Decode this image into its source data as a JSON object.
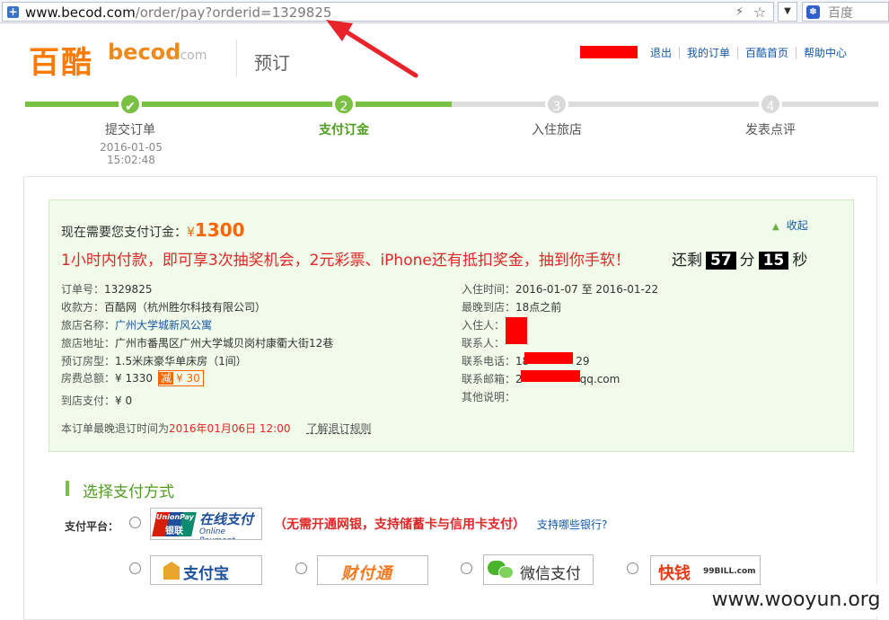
{
  "browser": {
    "url_host": "www.becod.com",
    "url_path": "/order/pay?orderid=1329825",
    "search_engine": "百度"
  },
  "header": {
    "logo_cn": "百酷",
    "logo_en": "becod",
    "logo_com": ".com",
    "page_heading": "预订",
    "nav": [
      "退出",
      "我的订单",
      "百酷首页",
      "帮助中心"
    ]
  },
  "steps": [
    {
      "label": "提交订单",
      "time": "2016-01-05 15:02:48",
      "status": "done",
      "mark": "✔"
    },
    {
      "label": "支付订金",
      "status": "current",
      "mark": "2"
    },
    {
      "label": "入住旅店",
      "status": "todo",
      "mark": "3"
    },
    {
      "label": "发表点评",
      "status": "todo",
      "mark": "4"
    }
  ],
  "order": {
    "amount_label": "现在需要您支付订金：",
    "currency": "¥",
    "amount": "1300",
    "collapse": "收起",
    "promo": "1小时内付款，即可享3次抽奖机会，2元彩票、iPhone还有抵扣奖金，抽到你手软！",
    "countdown_prefix": "还剩",
    "countdown_min": "57",
    "countdown_min_unit": "分",
    "countdown_sec": "15",
    "countdown_sec_unit": "秒",
    "left": [
      {
        "label": "订单号：",
        "value": "1329825"
      },
      {
        "label": "收款方：",
        "value": "百酷网（杭州胜尔科技有限公司）"
      },
      {
        "label": "旅店名称：",
        "value": "广州大学城新风公寓"
      },
      {
        "label": "旅店地址：",
        "value": "广州市番禺区广州大学城贝岗村康衢大街12巷"
      },
      {
        "label": "预订房型：",
        "value": "1.5米床豪华单床房（1间）"
      },
      {
        "label": "房费总额：",
        "value": "¥ 1330"
      },
      {
        "label": "到店支付：",
        "value": "¥ 0"
      }
    ],
    "discount_tag": "减",
    "discount_amount": "¥ 30",
    "right": [
      {
        "label": "入住时间：",
        "value": "2016-01-07 至 2016-01-22"
      },
      {
        "label": "最晚到店：",
        "value": "18点之前"
      },
      {
        "label": "入住人：",
        "value": ""
      },
      {
        "label": "联系人：",
        "value": ""
      },
      {
        "label": "联系电话：",
        "value": "18",
        "value_tail": "29"
      },
      {
        "label": "联系邮箱：",
        "value": "2",
        "value_tail": "qq.com"
      },
      {
        "label": "其他说明：",
        "value": ""
      }
    ],
    "refund_prefix": "本订单最晚退订时间为",
    "refund_deadline": "2016年01月06日 12:00",
    "refund_link": "了解退订规则"
  },
  "payment": {
    "title": "选择支付方式",
    "platform_label": "支付平台：",
    "unionpay_name": "UnionPay",
    "unionpay_cn": "银联",
    "unionpay_title": "在线支付",
    "unionpay_sub": "Online Payment",
    "unionpay_note": "（无需开通网银，支持储蓄卡与信用卡支付）",
    "banks_link": "支持哪些银行?",
    "alipay": "支付宝",
    "tenpay": "财付通",
    "wechat": "微信支付",
    "kuaiqian": "快钱",
    "kuaiqian_sub": "99BILL.com"
  },
  "watermark": "www.wooyun.org"
}
